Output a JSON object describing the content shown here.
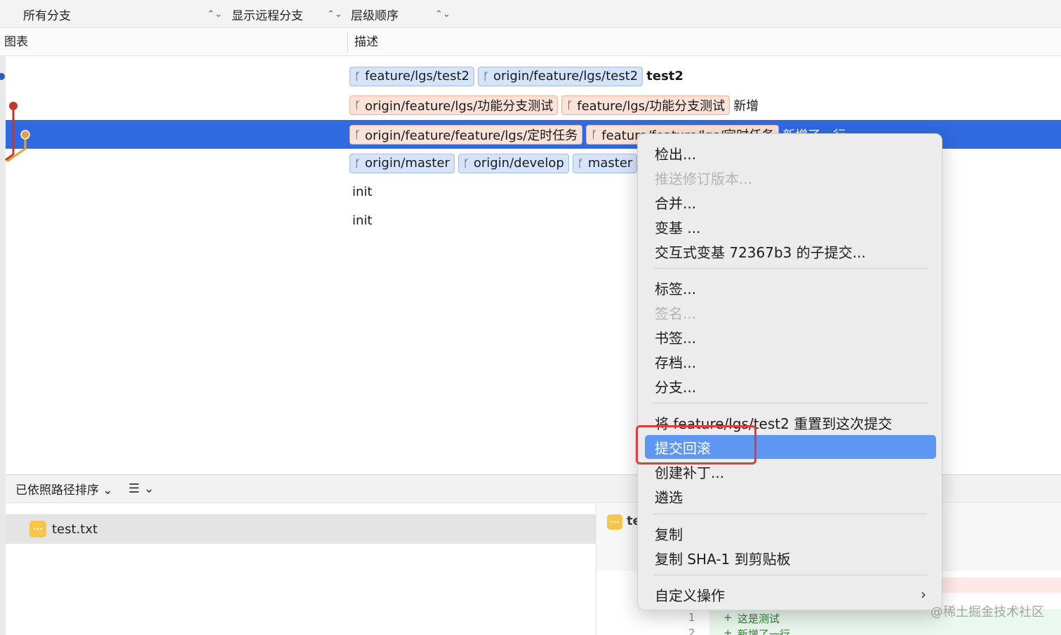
{
  "filters": {
    "branches": "所有分支",
    "remote": "显示远程分支",
    "order": "层级顺序"
  },
  "columns": {
    "graph": "图表",
    "description": "描述"
  },
  "commits": [
    {
      "refs": [
        "feature/lgs/test2",
        "origin/feature/lgs/test2"
      ],
      "ref_colors": [
        "blue",
        "blue"
      ],
      "message": "test2"
    },
    {
      "refs": [
        "origin/feature/lgs/功能分支测试",
        "feature/lgs/功能分支测试"
      ],
      "ref_colors": [
        "peach",
        "peach"
      ],
      "message": "新增"
    },
    {
      "refs": [
        "origin/feature/feature/lgs/定时任务",
        "feature/feature/lgs/定时任务"
      ],
      "ref_colors": [
        "peach",
        "peach"
      ],
      "message": "新增了一行"
    },
    {
      "refs": [
        "origin/master",
        "origin/develop",
        "master"
      ],
      "ref_colors": [
        "blue",
        "blue",
        "blue"
      ],
      "message": ""
    },
    {
      "refs": [],
      "message": "init"
    },
    {
      "refs": [],
      "message": "init"
    }
  ],
  "bottom": {
    "sort_label": "已依照路径排序",
    "file": "test.txt",
    "diff_file": "test.txt",
    "diff_lines": [
      {
        "num": "1",
        "sign": "+",
        "text": "这是测试"
      },
      {
        "num": "2",
        "sign": "+",
        "text": "新增了一行"
      }
    ]
  },
  "context_menu": {
    "items": [
      {
        "label": "检出...",
        "enabled": true
      },
      {
        "label": "推送修订版本...",
        "enabled": false
      },
      {
        "label": "合并...",
        "enabled": true
      },
      {
        "label": "变基 ...",
        "enabled": true
      },
      {
        "label": "交互式变基 72367b3 的子提交...",
        "enabled": true
      },
      {
        "label": "标签...",
        "enabled": true
      },
      {
        "label": "签名...",
        "enabled": false
      },
      {
        "label": "书签...",
        "enabled": true
      },
      {
        "label": "存档...",
        "enabled": true
      },
      {
        "label": "分支...",
        "enabled": true
      },
      {
        "label": "将 feature/lgs/test2 重置到这次提交",
        "enabled": true
      },
      {
        "label": "提交回滚",
        "enabled": true,
        "highlighted": true
      },
      {
        "label": "创建补丁...",
        "enabled": true
      },
      {
        "label": "遴选",
        "enabled": true
      },
      {
        "label": "复制",
        "enabled": true
      },
      {
        "label": "复制 SHA-1 到剪贴板",
        "enabled": true
      },
      {
        "label": "自定义操作",
        "enabled": true
      }
    ]
  },
  "watermark": "@稀土掘金技术社区",
  "colors": {
    "selection": "#2f6ae0",
    "menu_highlight": "#5e97f2",
    "annotation": "#e23b3b",
    "graph_red": "#c0392b",
    "graph_orange": "#e8a13a",
    "graph_blue": "#2d5fb7"
  }
}
